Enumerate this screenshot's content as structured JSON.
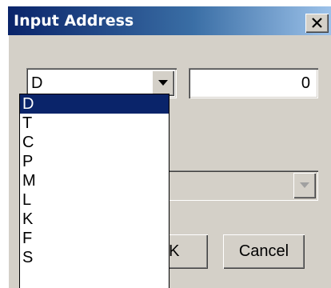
{
  "window": {
    "title": "Input Address"
  },
  "address_type": {
    "selected": "D",
    "options": [
      "D",
      "T",
      "C",
      "P",
      "M",
      "L",
      "K",
      "F",
      "S"
    ]
  },
  "address_number": {
    "value": "0"
  },
  "buttons": {
    "ok_label": "OK",
    "cancel_label": "Cancel"
  },
  "colors": {
    "selection": "#0a246a",
    "dialog_face": "#d4d0c8",
    "titlebar_start": "#0a246a",
    "titlebar_end": "#a6caf0"
  }
}
